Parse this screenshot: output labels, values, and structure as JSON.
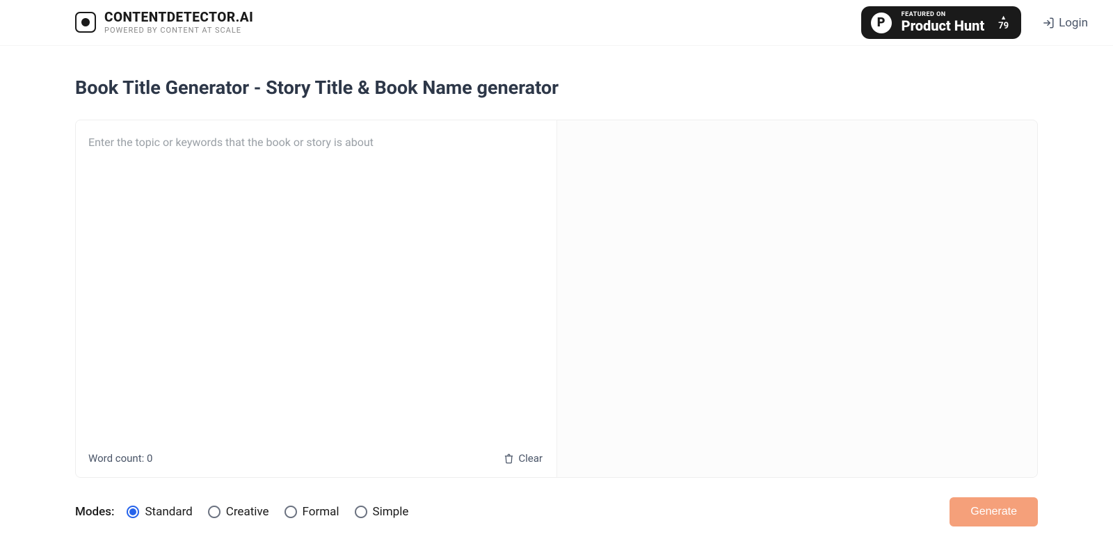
{
  "brand": {
    "title": "CONTENTDETECTOR.AI",
    "subtitle": "POWERED BY CONTENT AT SCALE"
  },
  "badge": {
    "p_letter": "P",
    "featured": "FEATURED ON",
    "name": "Product Hunt",
    "upvotes": "79",
    "caret": "▲"
  },
  "login_label": "Login",
  "page_title": "Book Title Generator - Story Title & Book Name generator",
  "input": {
    "placeholder": "Enter the topic or keywords that the book or story is about",
    "value": ""
  },
  "word_count_label": "Word count: 0",
  "clear_label": "Clear",
  "modes_label": "Modes:",
  "modes": [
    {
      "label": "Standard",
      "selected": true
    },
    {
      "label": "Creative",
      "selected": false
    },
    {
      "label": "Formal",
      "selected": false
    },
    {
      "label": "Simple",
      "selected": false
    }
  ],
  "generate_label": "Generate"
}
